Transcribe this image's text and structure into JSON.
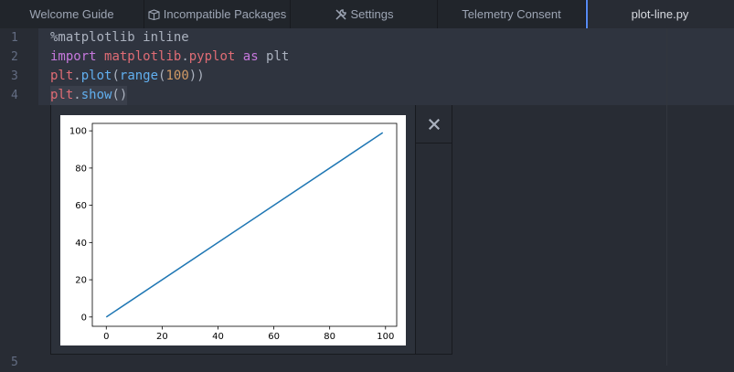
{
  "tabs": [
    {
      "label": "Welcome Guide",
      "icon": "",
      "active": false
    },
    {
      "label": "Incompatible Packages",
      "icon": "package-icon",
      "active": false
    },
    {
      "label": "Settings",
      "icon": "tools-icon",
      "active": false
    },
    {
      "label": "Telemetry Consent",
      "icon": "",
      "active": false
    },
    {
      "label": "plot-line.py",
      "icon": "",
      "active": true
    }
  ],
  "editor": {
    "line_numbers": [
      "1",
      "2",
      "3",
      "4",
      "5"
    ],
    "lines": [
      [
        {
          "t": "%matplotlib inline",
          "c": "plain"
        }
      ],
      [
        {
          "t": "import",
          "c": "kw"
        },
        {
          "t": " ",
          "c": "plain"
        },
        {
          "t": "matplotlib",
          "c": "mod"
        },
        {
          "t": ".",
          "c": "plain"
        },
        {
          "t": "pyplot",
          "c": "mod"
        },
        {
          "t": " ",
          "c": "plain"
        },
        {
          "t": "as",
          "c": "kw"
        },
        {
          "t": " plt",
          "c": "plain"
        }
      ],
      [
        {
          "t": "plt",
          "c": "mod"
        },
        {
          "t": ".",
          "c": "plain"
        },
        {
          "t": "plot",
          "c": "fn"
        },
        {
          "t": "(",
          "c": "plain"
        },
        {
          "t": "range",
          "c": "fn"
        },
        {
          "t": "(",
          "c": "plain"
        },
        {
          "t": "100",
          "c": "num"
        },
        {
          "t": "))",
          "c": "plain"
        }
      ],
      [
        {
          "t": "plt",
          "c": "mod"
        },
        {
          "t": ".",
          "c": "plain"
        },
        {
          "t": "show",
          "c": "fn"
        },
        {
          "t": "()",
          "c": "plain"
        }
      ]
    ]
  },
  "result": {
    "close_symbol": "×"
  },
  "colors": {
    "line": "#1f77b4",
    "tab_accent": "#568af2"
  },
  "chart_data": {
    "type": "line",
    "x": [
      0,
      99
    ],
    "y": [
      0,
      99
    ],
    "xlim": [
      -5,
      104
    ],
    "ylim": [
      -5,
      104
    ],
    "xticks": [
      "0",
      "20",
      "40",
      "60",
      "80",
      "100"
    ],
    "yticks": [
      "0",
      "20",
      "40",
      "60",
      "80",
      "100"
    ],
    "title": "",
    "xlabel": "",
    "ylabel": "",
    "grid": false
  }
}
